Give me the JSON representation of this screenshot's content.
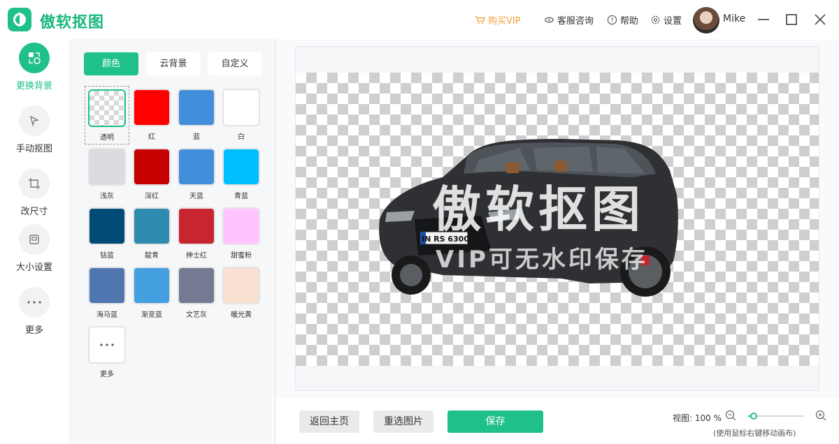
{
  "app": {
    "title": "傲软抠图",
    "accent": "#20c08a"
  },
  "topbar": {
    "vip_label": "购买VIP",
    "support_label": "客服咨询",
    "help_label": "帮助",
    "settings_label": "设置",
    "username": "Mike"
  },
  "leftnav": {
    "items": [
      {
        "label": "更换背景",
        "icon": "swap-background-icon",
        "active": true
      },
      {
        "label": "手动抠图",
        "icon": "manual-cutout-icon",
        "active": false
      },
      {
        "label": "改尺寸",
        "icon": "crop-icon",
        "active": false
      },
      {
        "label": "大小设置",
        "icon": "size-settings-icon",
        "active": false
      },
      {
        "label": "更多",
        "icon": "more-icon",
        "active": false
      }
    ]
  },
  "panel": {
    "tabs": [
      {
        "label": "颜色",
        "active": true
      },
      {
        "label": "云背景",
        "active": false
      },
      {
        "label": "自定义",
        "active": false
      }
    ],
    "swatches": [
      {
        "label": "透明",
        "color": "transparent",
        "selected": true
      },
      {
        "label": "红",
        "color": "#ff0000"
      },
      {
        "label": "蓝",
        "color": "#438edb"
      },
      {
        "label": "白",
        "color": "#ffffff"
      },
      {
        "label": "浅灰",
        "color": "#dcdce0"
      },
      {
        "label": "深红",
        "color": "#c40000"
      },
      {
        "label": "天蓝",
        "color": "#438edb"
      },
      {
        "label": "青蓝",
        "color": "#00bfff"
      },
      {
        "label": "钴蓝",
        "color": "#004b75"
      },
      {
        "label": "靛青",
        "color": "#2f8cb0"
      },
      {
        "label": "绅士红",
        "color": "#c9252f"
      },
      {
        "label": "甜蜜粉",
        "color": "#ffc3ff"
      },
      {
        "label": "海马蓝",
        "color": "#4f76af"
      },
      {
        "label": "渐变蓝",
        "color": "#439fe0"
      },
      {
        "label": "文艺灰",
        "color": "#737a91"
      },
      {
        "label": "暖光黄",
        "color": "#fae0d1"
      },
      {
        "label": "更多",
        "color": "more"
      }
    ]
  },
  "preview": {
    "watermark_title": "傲软抠图",
    "watermark_sub": "VIP可无水印保存",
    "plate_text": "IN RS 6300"
  },
  "bottombar": {
    "home_label": "返回主页",
    "reselect_label": "重选图片",
    "save_label": "保存",
    "zoom_prefix": "视图:",
    "zoom_value": "100 %",
    "zoom_level": 0.1,
    "hint": "(使用鼠标右键移动画布)"
  }
}
